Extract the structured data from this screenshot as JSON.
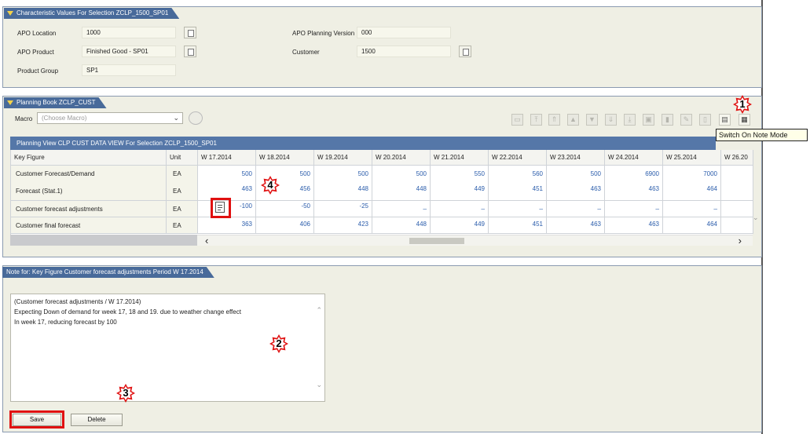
{
  "characteristics": {
    "title": "Characteristic Values For Selection ZCLP_1500_SP01",
    "fields": [
      {
        "label": "APO Location",
        "value": "1000"
      },
      {
        "label": "APO Product",
        "value": "Finished Good - SP01"
      },
      {
        "label": "Product Group",
        "value": "SP1"
      },
      {
        "label": "APO Planning Version",
        "value": "000"
      },
      {
        "label": "Customer",
        "value": "1500"
      }
    ]
  },
  "planning_book": {
    "title": "Planning Book ZCLP_CUST",
    "macro_label": "Macro",
    "macro_placeholder": "(Choose Macro)",
    "tooltip": "Switch On Note Mode",
    "grid_title": "Planning View CLP CUST DATA VIEW For Selection ZCLP_1500_SP01",
    "columns": [
      "Key Figure",
      "Unit",
      "W 17.2014",
      "W 18.2014",
      "W 19.2014",
      "W 20.2014",
      "W 21.2014",
      "W 22.2014",
      "W 23.2014",
      "W 24.2014",
      "W 25.2014",
      "W 26.20"
    ],
    "rows": [
      {
        "key_figure": "Customer Forecast/Demand",
        "unit": "EA",
        "values": [
          "500",
          "500",
          "500",
          "500",
          "550",
          "560",
          "500",
          "6900",
          "7000",
          ""
        ]
      },
      {
        "key_figure": "Forecast (Stat.1)",
        "unit": "EA",
        "values": [
          "463",
          "456",
          "448",
          "448",
          "449",
          "451",
          "463",
          "463",
          "464",
          ""
        ]
      },
      {
        "key_figure": "Customer forecast adjustments",
        "unit": "EA",
        "values": [
          "-100",
          "-50",
          "-25",
          "_",
          "_",
          "_",
          "_",
          "_",
          "_",
          ""
        ]
      },
      {
        "key_figure": "Customer final forecast",
        "unit": "EA",
        "values": [
          "363",
          "406",
          "423",
          "448",
          "449",
          "451",
          "463",
          "463",
          "464",
          ""
        ]
      }
    ],
    "scroll_left": "‹",
    "scroll_right": "›"
  },
  "note": {
    "title": "Note for: Key Figure Customer forecast adjustments Period W 17.2014",
    "lines": [
      "(Customer forecast adjustments / W 17.2014)",
      "Expecting Down of demand for week 17, 18 and 19. due to weather change effect",
      "In week 17, reducing forecast by 100"
    ],
    "save_label": "Save",
    "delete_label": "Delete"
  },
  "annotations": [
    "1",
    "2",
    "3",
    "4"
  ],
  "colors": {
    "tab": "#486a9a",
    "grid_title": "#5577a8",
    "highlight": "#e01010",
    "value_text": "#2a5cab"
  }
}
